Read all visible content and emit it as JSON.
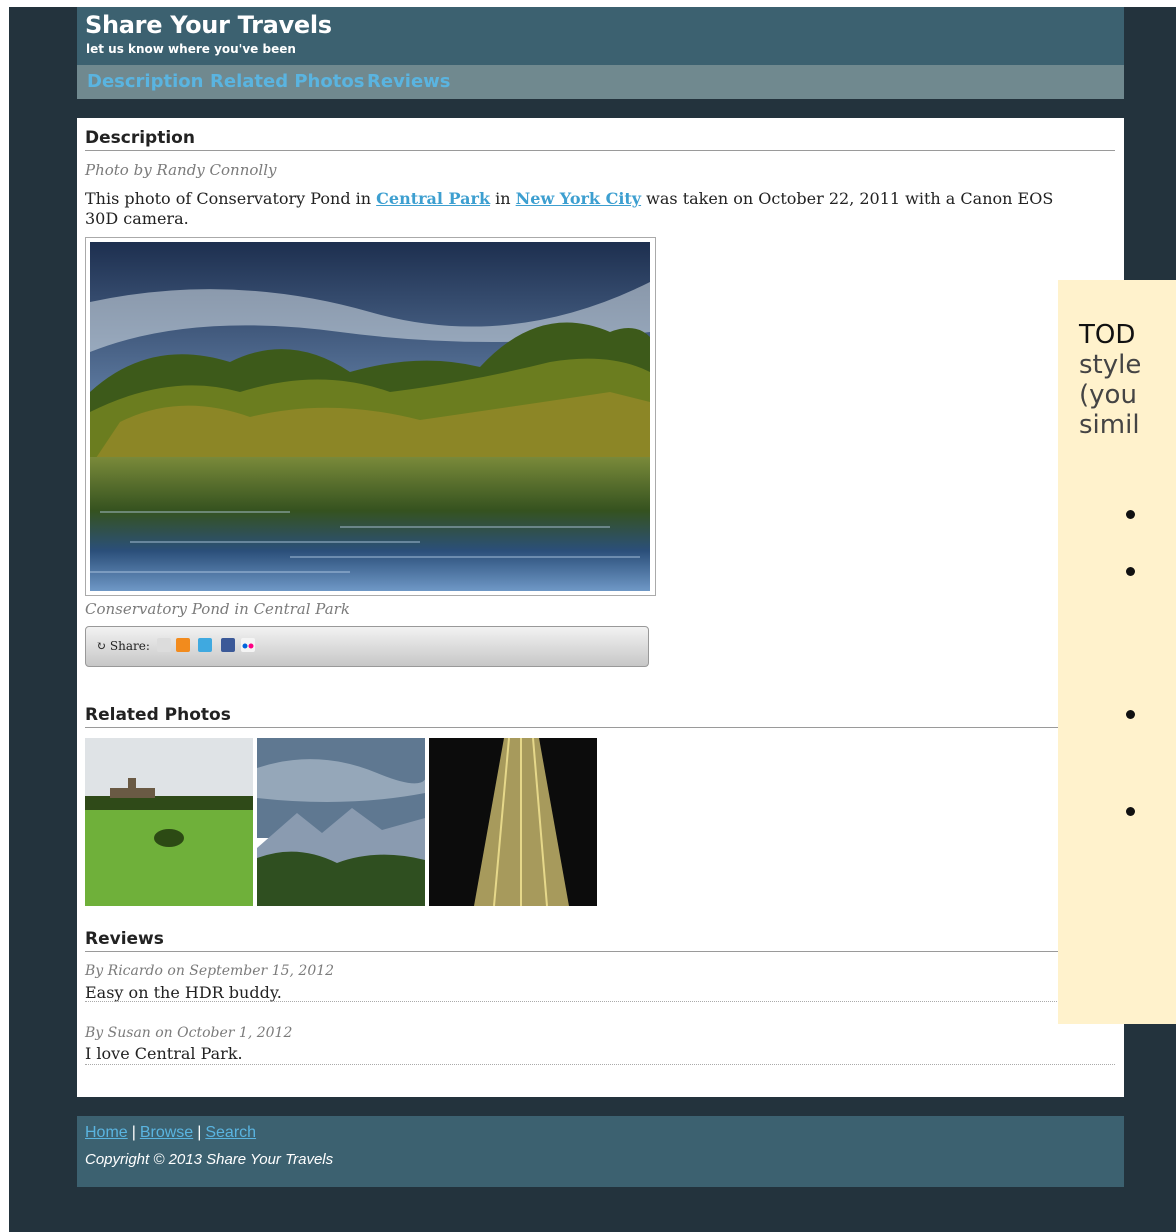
{
  "header": {
    "title": "Share Your Travels",
    "tagline": "let us know where you've been"
  },
  "nav": {
    "items": [
      {
        "label": "Description"
      },
      {
        "label": "Related Photos"
      },
      {
        "label": "Reviews"
      }
    ]
  },
  "description": {
    "heading": "Description",
    "byline": "Photo by Randy Connolly",
    "text_before": "This photo of Conservatory Pond in ",
    "link_park": "Central Park",
    "text_mid": " in ",
    "link_city": "New York City",
    "text_after": " was taken on October 22, 2011 with a Canon EOS 30D camera.",
    "caption": "Conservatory Pond in Central Park",
    "share_label": "Share:"
  },
  "related": {
    "heading": "Related Photos"
  },
  "reviews": {
    "heading": "Reviews",
    "items": [
      {
        "by": "By Ricardo on September 15, 2012",
        "text": "Easy on the HDR buddy."
      },
      {
        "by": "By Susan on October 1, 2012",
        "text": "I love Central Park."
      }
    ]
  },
  "todo": {
    "lines": [
      "TOD",
      "style",
      "(you",
      "simil"
    ]
  },
  "footer": {
    "links": [
      "Home",
      "Browse",
      "Search"
    ],
    "separator": "|",
    "copyright": "Copyright © 2013 Share Your Travels"
  },
  "colors": {
    "page_bg": "#23333d",
    "header_bg": "#3c6170",
    "nav_bg": "#70898f",
    "link": "#5ab4e0",
    "todo_bg": "#fff2cc"
  }
}
